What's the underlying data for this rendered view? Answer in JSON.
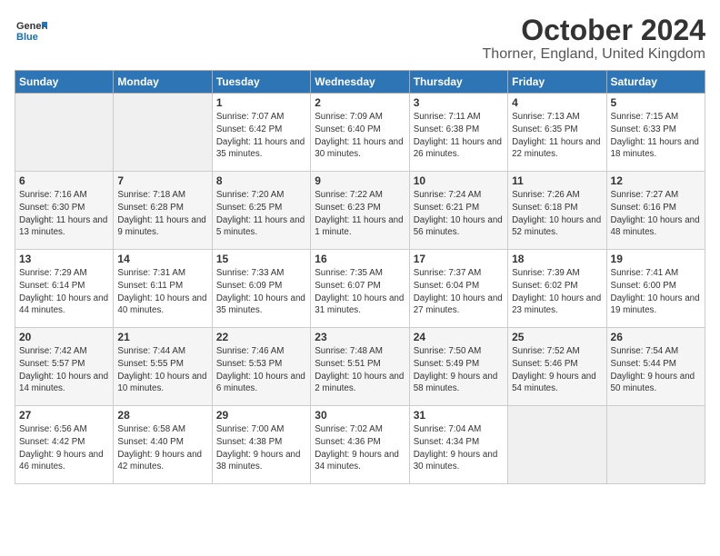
{
  "header": {
    "logo_general": "General",
    "logo_blue": "Blue",
    "title": "October 2024",
    "location": "Thorner, England, United Kingdom"
  },
  "days_of_week": [
    "Sunday",
    "Monday",
    "Tuesday",
    "Wednesday",
    "Thursday",
    "Friday",
    "Saturday"
  ],
  "weeks": [
    [
      {
        "num": "",
        "info": ""
      },
      {
        "num": "",
        "info": ""
      },
      {
        "num": "1",
        "info": "Sunrise: 7:07 AM\nSunset: 6:42 PM\nDaylight: 11 hours and 35 minutes."
      },
      {
        "num": "2",
        "info": "Sunrise: 7:09 AM\nSunset: 6:40 PM\nDaylight: 11 hours and 30 minutes."
      },
      {
        "num": "3",
        "info": "Sunrise: 7:11 AM\nSunset: 6:38 PM\nDaylight: 11 hours and 26 minutes."
      },
      {
        "num": "4",
        "info": "Sunrise: 7:13 AM\nSunset: 6:35 PM\nDaylight: 11 hours and 22 minutes."
      },
      {
        "num": "5",
        "info": "Sunrise: 7:15 AM\nSunset: 6:33 PM\nDaylight: 11 hours and 18 minutes."
      }
    ],
    [
      {
        "num": "6",
        "info": "Sunrise: 7:16 AM\nSunset: 6:30 PM\nDaylight: 11 hours and 13 minutes."
      },
      {
        "num": "7",
        "info": "Sunrise: 7:18 AM\nSunset: 6:28 PM\nDaylight: 11 hours and 9 minutes."
      },
      {
        "num": "8",
        "info": "Sunrise: 7:20 AM\nSunset: 6:25 PM\nDaylight: 11 hours and 5 minutes."
      },
      {
        "num": "9",
        "info": "Sunrise: 7:22 AM\nSunset: 6:23 PM\nDaylight: 11 hours and 1 minute."
      },
      {
        "num": "10",
        "info": "Sunrise: 7:24 AM\nSunset: 6:21 PM\nDaylight: 10 hours and 56 minutes."
      },
      {
        "num": "11",
        "info": "Sunrise: 7:26 AM\nSunset: 6:18 PM\nDaylight: 10 hours and 52 minutes."
      },
      {
        "num": "12",
        "info": "Sunrise: 7:27 AM\nSunset: 6:16 PM\nDaylight: 10 hours and 48 minutes."
      }
    ],
    [
      {
        "num": "13",
        "info": "Sunrise: 7:29 AM\nSunset: 6:14 PM\nDaylight: 10 hours and 44 minutes."
      },
      {
        "num": "14",
        "info": "Sunrise: 7:31 AM\nSunset: 6:11 PM\nDaylight: 10 hours and 40 minutes."
      },
      {
        "num": "15",
        "info": "Sunrise: 7:33 AM\nSunset: 6:09 PM\nDaylight: 10 hours and 35 minutes."
      },
      {
        "num": "16",
        "info": "Sunrise: 7:35 AM\nSunset: 6:07 PM\nDaylight: 10 hours and 31 minutes."
      },
      {
        "num": "17",
        "info": "Sunrise: 7:37 AM\nSunset: 6:04 PM\nDaylight: 10 hours and 27 minutes."
      },
      {
        "num": "18",
        "info": "Sunrise: 7:39 AM\nSunset: 6:02 PM\nDaylight: 10 hours and 23 minutes."
      },
      {
        "num": "19",
        "info": "Sunrise: 7:41 AM\nSunset: 6:00 PM\nDaylight: 10 hours and 19 minutes."
      }
    ],
    [
      {
        "num": "20",
        "info": "Sunrise: 7:42 AM\nSunset: 5:57 PM\nDaylight: 10 hours and 14 minutes."
      },
      {
        "num": "21",
        "info": "Sunrise: 7:44 AM\nSunset: 5:55 PM\nDaylight: 10 hours and 10 minutes."
      },
      {
        "num": "22",
        "info": "Sunrise: 7:46 AM\nSunset: 5:53 PM\nDaylight: 10 hours and 6 minutes."
      },
      {
        "num": "23",
        "info": "Sunrise: 7:48 AM\nSunset: 5:51 PM\nDaylight: 10 hours and 2 minutes."
      },
      {
        "num": "24",
        "info": "Sunrise: 7:50 AM\nSunset: 5:49 PM\nDaylight: 9 hours and 58 minutes."
      },
      {
        "num": "25",
        "info": "Sunrise: 7:52 AM\nSunset: 5:46 PM\nDaylight: 9 hours and 54 minutes."
      },
      {
        "num": "26",
        "info": "Sunrise: 7:54 AM\nSunset: 5:44 PM\nDaylight: 9 hours and 50 minutes."
      }
    ],
    [
      {
        "num": "27",
        "info": "Sunrise: 6:56 AM\nSunset: 4:42 PM\nDaylight: 9 hours and 46 minutes."
      },
      {
        "num": "28",
        "info": "Sunrise: 6:58 AM\nSunset: 4:40 PM\nDaylight: 9 hours and 42 minutes."
      },
      {
        "num": "29",
        "info": "Sunrise: 7:00 AM\nSunset: 4:38 PM\nDaylight: 9 hours and 38 minutes."
      },
      {
        "num": "30",
        "info": "Sunrise: 7:02 AM\nSunset: 4:36 PM\nDaylight: 9 hours and 34 minutes."
      },
      {
        "num": "31",
        "info": "Sunrise: 7:04 AM\nSunset: 4:34 PM\nDaylight: 9 hours and 30 minutes."
      },
      {
        "num": "",
        "info": ""
      },
      {
        "num": "",
        "info": ""
      }
    ]
  ]
}
